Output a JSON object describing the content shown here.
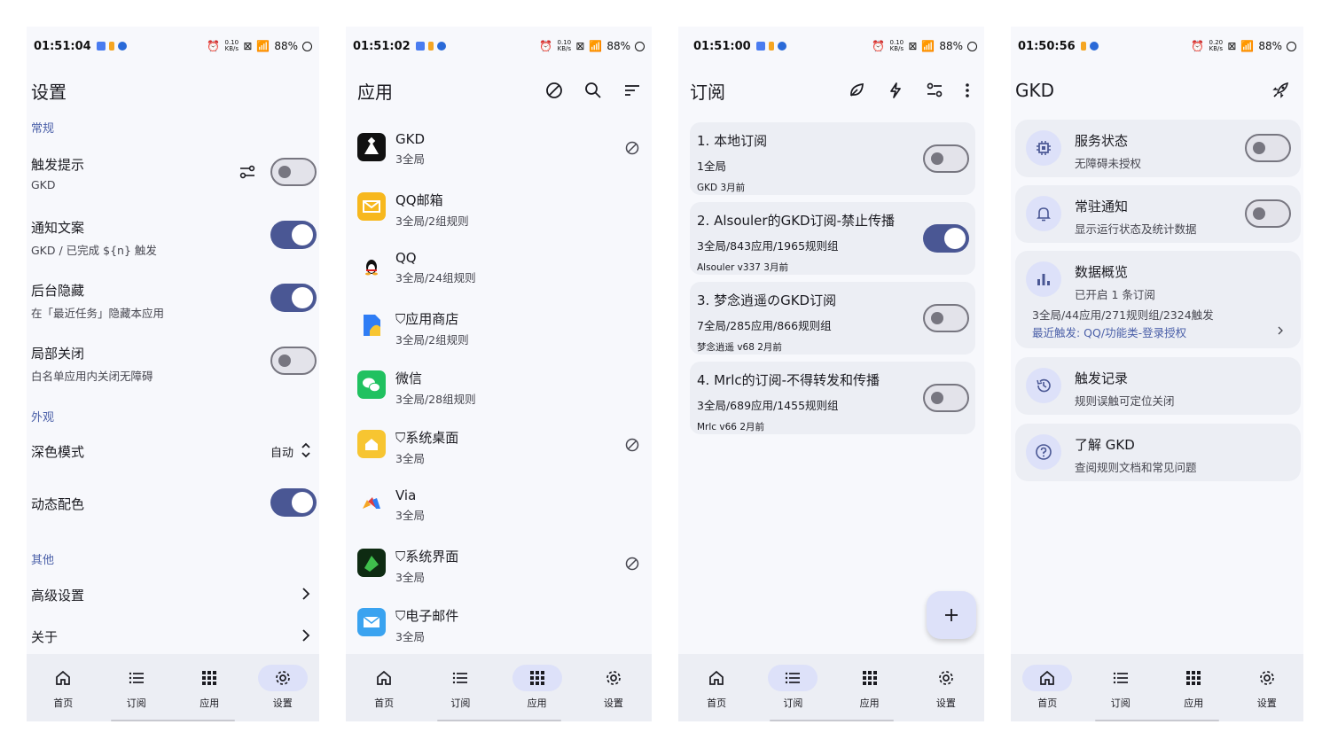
{
  "status_bars": [
    {
      "time": "01:51:04",
      "net": "0.10",
      "battery": "88%"
    },
    {
      "time": "01:51:02",
      "net": "0.10",
      "battery": "88%"
    },
    {
      "time": "01:51:00",
      "net": "0.10",
      "battery": "88%"
    },
    {
      "time": "01:50:56",
      "net": "0.20",
      "battery": "88%"
    }
  ],
  "nav": {
    "home": "首页",
    "subs": "订阅",
    "apps": "应用",
    "settings": "设置"
  },
  "settings": {
    "title": "设置",
    "sec_general": "常规",
    "trigger_title": "触发提示",
    "trigger_sub": "GKD",
    "notify_title": "通知文案",
    "notify_sub": "GKD / 已完成 ${n} 触发",
    "hide_title": "后台隐藏",
    "hide_sub": "在「最近任务」隐藏本应用",
    "local_title": "局部关闭",
    "local_sub": "白名单应用内关闭无障碍",
    "sec_appearance": "外观",
    "dark_title": "深色模式",
    "dark_value": "自动",
    "dynamic_title": "动态配色",
    "sec_other": "其他",
    "advanced": "高级设置",
    "about": "关于"
  },
  "apps": {
    "title": "应用",
    "list": [
      {
        "name": "GKD",
        "sub": "3全局"
      },
      {
        "name": "QQ邮箱",
        "sub": "3全局/2组规则"
      },
      {
        "name": "QQ",
        "sub": "3全局/24组规则"
      },
      {
        "name": "应用商店",
        "sub": "3全局/2组规则"
      },
      {
        "name": "微信",
        "sub": "3全局/28组规则"
      },
      {
        "name": "系统桌面",
        "sub": "3全局"
      },
      {
        "name": "Via",
        "sub": "3全局"
      },
      {
        "name": "系统界面",
        "sub": "3全局"
      },
      {
        "name": "电子邮件",
        "sub": "3全局"
      }
    ]
  },
  "subs": {
    "title": "订阅",
    "list": [
      {
        "title": "1. 本地订阅",
        "sub": "1全局",
        "meta": "GKD  3月前",
        "enabled": false
      },
      {
        "title": "2. Alsouler的GKD订阅-禁止传播",
        "sub": "3全局/843应用/1965规则组",
        "meta": "Alsouler  v337  3月前",
        "enabled": true
      },
      {
        "title": "3. 梦念逍遥のGKD订阅",
        "sub": "7全局/285应用/866规则组",
        "meta": "梦念逍遥  v68  2月前",
        "enabled": false
      },
      {
        "title": "4. Mrlc的订阅-不得转发和传播",
        "sub": "3全局/689应用/1455规则组",
        "meta": "Mrlc  v66  2月前",
        "enabled": false
      }
    ]
  },
  "home": {
    "title": "GKD",
    "service_title": "服务状态",
    "service_sub": "无障碍未授权",
    "notif_title": "常驻通知",
    "notif_sub": "显示运行状态及统计数据",
    "data_title": "数据概览",
    "data_sub": "已开启 1 条订阅",
    "data_stats": "3全局/44应用/271规则组/2324触发",
    "data_recent": "最近触发: QQ/功能类-登录授权",
    "log_title": "触发记录",
    "log_sub": "规则误触可定位关闭",
    "learn_title": "了解 GKD",
    "learn_sub": "查阅规则文档和常见问题"
  },
  "colors": {
    "accent": "#4a5794",
    "link": "#4a5fa8",
    "pill": "#dde1f9",
    "card": "#eceef4",
    "bg": "#f7f8fc"
  }
}
